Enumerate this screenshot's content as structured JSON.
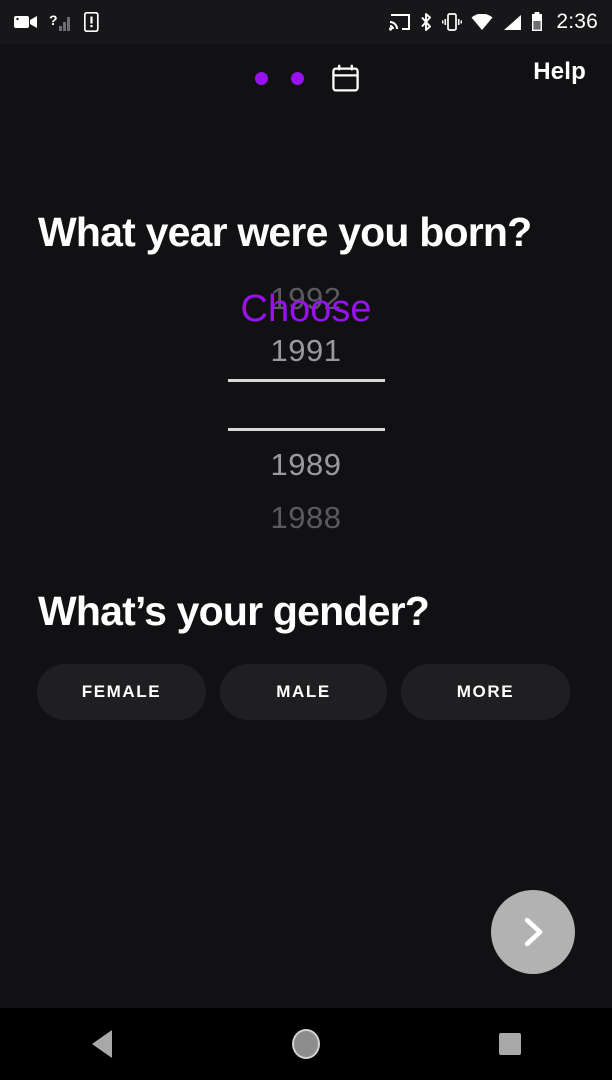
{
  "status_bar": {
    "time": "2:36",
    "left_icons": [
      "video-camera-icon",
      "signal-unknown-icon",
      "phone-alert-icon"
    ],
    "right_icons": [
      "cast-icon",
      "bluetooth-icon",
      "vibrate-icon",
      "wifi-icon",
      "cellular-signal-icon",
      "battery-icon"
    ]
  },
  "header": {
    "pager_dots": 2,
    "pager_color": "#9812f0",
    "calendar_icon": "calendar-icon",
    "help_label": "Help"
  },
  "year_section": {
    "question": "What year were you born?",
    "options": [
      {
        "label": "1992",
        "state": "far"
      },
      {
        "label": "1991",
        "state": "near"
      },
      {
        "label": "Choose",
        "state": "selected"
      },
      {
        "label": "1989",
        "state": "near"
      },
      {
        "label": "1988",
        "state": "far"
      }
    ],
    "selected_label": "Choose",
    "selected_color": "#9812f0"
  },
  "gender_section": {
    "question": "What’s your gender?",
    "buttons": [
      {
        "label": "FEMALE"
      },
      {
        "label": "MALE"
      },
      {
        "label": "MORE"
      }
    ]
  },
  "next_button": {
    "icon": "chevron-right-icon",
    "color": "#b2b2b2"
  },
  "nav_bar": {
    "back": "back-triangle-icon",
    "home": "home-circle-icon",
    "recents": "recents-square-icon"
  }
}
